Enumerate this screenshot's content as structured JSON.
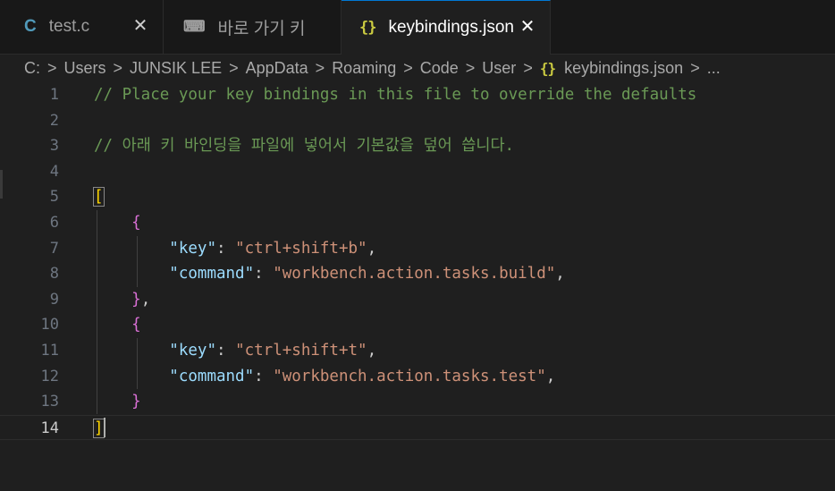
{
  "tabs": [
    {
      "icon": "C",
      "label": "test.c",
      "close": "✕"
    },
    {
      "icon": "⌨",
      "label": "바로 가기 키"
    },
    {
      "icon": "{}",
      "label": "keybindings.json",
      "close": "✕"
    }
  ],
  "breadcrumb": {
    "items": [
      "C:",
      "Users",
      "JUNSIK LEE",
      "AppData",
      "Roaming",
      "Code",
      "User"
    ],
    "file_icon": "{}",
    "file": "keybindings.json",
    "more": "..."
  },
  "editor": {
    "lines": [
      {
        "n": "1",
        "comment": "// Place your key bindings in this file to override the defaults"
      },
      {
        "n": "2"
      },
      {
        "n": "3",
        "comment": "// 아래 키 바인딩을 파일에 넣어서 기본값을 덮어 씁니다."
      },
      {
        "n": "4"
      },
      {
        "n": "5",
        "open_bracket": "["
      },
      {
        "n": "6",
        "brace": "{"
      },
      {
        "n": "7",
        "key": "\"key\"",
        "colon": ": ",
        "value": "\"ctrl+shift+b\"",
        "comma": ","
      },
      {
        "n": "8",
        "key": "\"command\"",
        "colon": ": ",
        "value": "\"workbench.action.tasks.build\"",
        "comma": ","
      },
      {
        "n": "9",
        "brace": "}",
        "comma": ","
      },
      {
        "n": "10",
        "brace": "{"
      },
      {
        "n": "11",
        "key": "\"key\"",
        "colon": ": ",
        "value": "\"ctrl+shift+t\"",
        "comma": ","
      },
      {
        "n": "12",
        "key": "\"command\"",
        "colon": ": ",
        "value": "\"workbench.action.tasks.test\"",
        "comma": ","
      },
      {
        "n": "13",
        "brace": "}"
      },
      {
        "n": "14",
        "close_bracket": "]"
      }
    ]
  }
}
